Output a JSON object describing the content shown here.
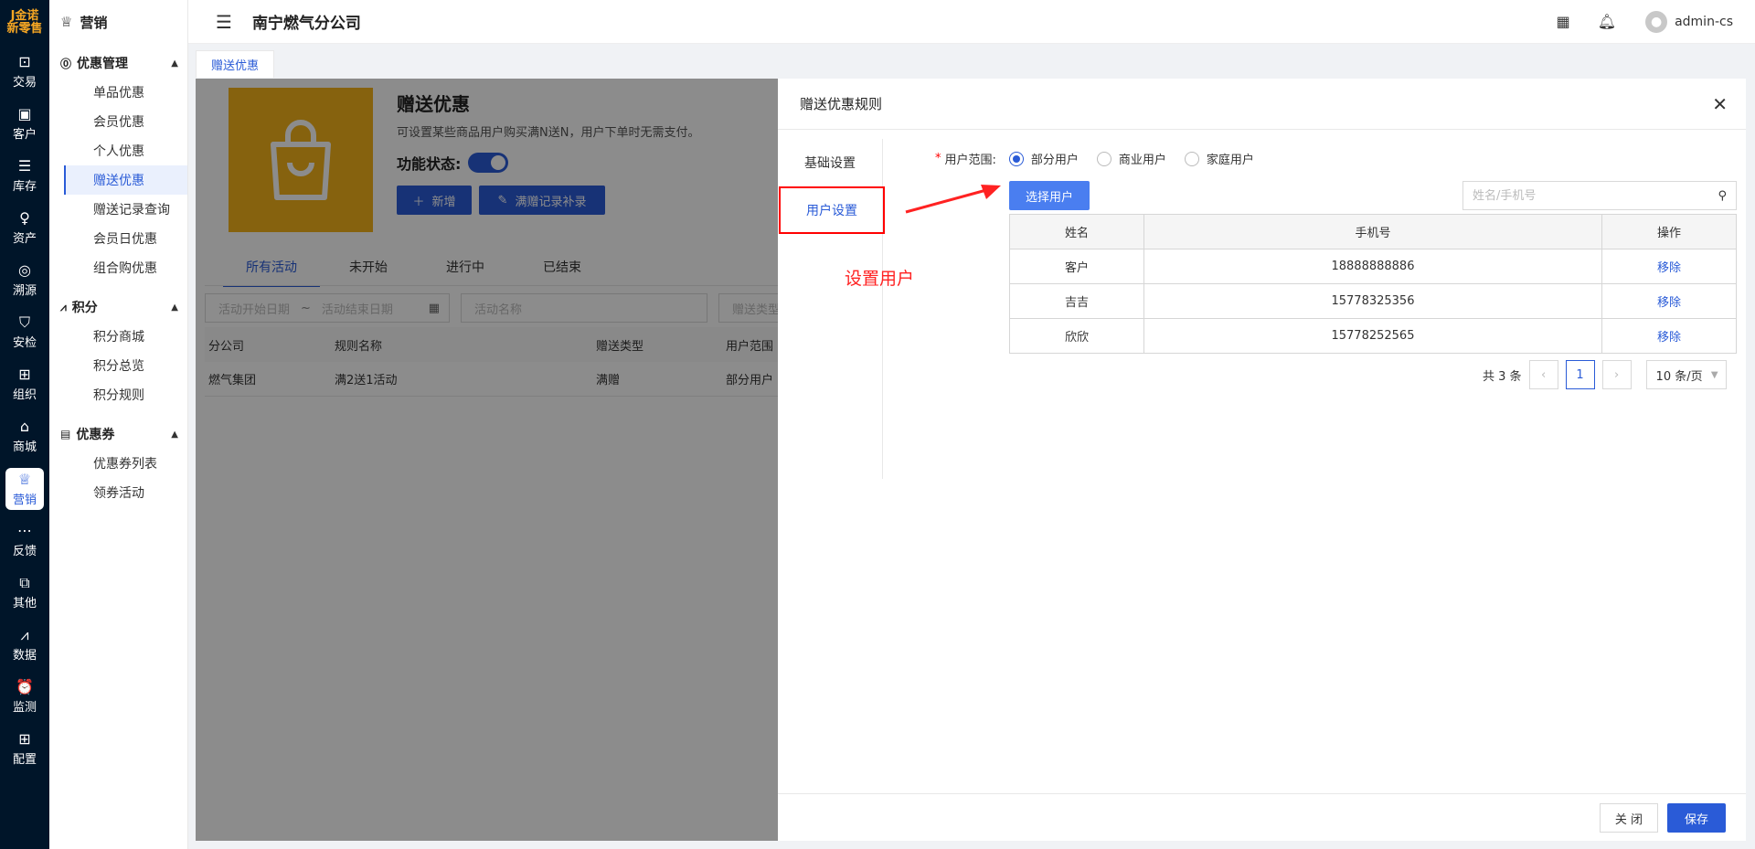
{
  "rail": {
    "logo_line1": "J金诺",
    "logo_line2": "新零售",
    "items": [
      {
        "label": "交易",
        "icon": "bag-icon"
      },
      {
        "label": "客户",
        "icon": "id-card-icon"
      },
      {
        "label": "库存",
        "icon": "inventory-icon"
      },
      {
        "label": "资产",
        "icon": "bulb-icon"
      },
      {
        "label": "溯源",
        "icon": "compass-icon"
      },
      {
        "label": "安检",
        "icon": "shield-icon"
      },
      {
        "label": "组织",
        "icon": "org-icon"
      },
      {
        "label": "商城",
        "icon": "store-icon"
      },
      {
        "label": "营销",
        "icon": "trophy-icon"
      },
      {
        "label": "反馈",
        "icon": "chat-icon"
      },
      {
        "label": "其他",
        "icon": "blocks-icon"
      },
      {
        "label": "数据",
        "icon": "chart-icon"
      },
      {
        "label": "监测",
        "icon": "alarm-icon"
      },
      {
        "label": "配置",
        "icon": "grid-icon"
      }
    ]
  },
  "sidebar": {
    "title": "营销",
    "groups": [
      {
        "label": "优惠管理",
        "items": [
          "单品优惠",
          "会员优惠",
          "个人优惠",
          "赠送优惠",
          "赠送记录查询",
          "会员日优惠",
          "组合购优惠"
        ]
      },
      {
        "label": "积分",
        "items": [
          "积分商城",
          "积分总览",
          "积分规则"
        ]
      },
      {
        "label": "优惠券",
        "items": [
          "优惠券列表",
          "领券活动"
        ]
      }
    ]
  },
  "header": {
    "title": "南宁燃气分公司",
    "user": "admin-cs"
  },
  "tabstrip": {
    "tab": "赠送优惠"
  },
  "page": {
    "title": "赠送优惠",
    "desc": "可设置某些商品用户购买满N送N，用户下单时无需支付。",
    "status_label": "功能状态:",
    "add_button": "新增",
    "supplement_button": "满赠记录补录",
    "tabs": [
      "所有活动",
      "未开始",
      "进行中",
      "已结束"
    ],
    "filters": {
      "start_placeholder": "活动开始日期",
      "range_sep": "~",
      "end_placeholder": "活动结束日期",
      "name_placeholder": "活动名称",
      "type_placeholder": "赠送类型"
    },
    "table": {
      "columns": [
        "分公司",
        "规则名称",
        "赠送类型",
        "用户范围"
      ],
      "rows": [
        [
          "燃气集团",
          "满2送1活动",
          "满赠",
          "部分用户"
        ]
      ]
    }
  },
  "drawer": {
    "title": "赠送优惠规则",
    "nav": [
      "基础设置",
      "用户设置"
    ],
    "annotation": "设置用户",
    "range_label": "用户范围:",
    "range_options": [
      "部分用户",
      "商业用户",
      "家庭用户"
    ],
    "select_button": "选择用户",
    "search_placeholder": "姓名/手机号",
    "columns": [
      "姓名",
      "手机号",
      "操作"
    ],
    "rows": [
      {
        "name": "客户",
        "phone": "18888888886",
        "op": "移除"
      },
      {
        "name": "吉吉",
        "phone": "15778325356",
        "op": "移除"
      },
      {
        "name": "欣欣",
        "phone": "15778252565",
        "op": "移除"
      }
    ],
    "pager": {
      "total": "共 3 条",
      "current": "1",
      "size": "10 条/页"
    },
    "close_button": "关 闭",
    "save_button": "保存"
  },
  "colors": {
    "primary": "#2a5bd7",
    "rail_bg": "#001529",
    "annotation": "#ff2222",
    "hero": "#f5b31b"
  }
}
